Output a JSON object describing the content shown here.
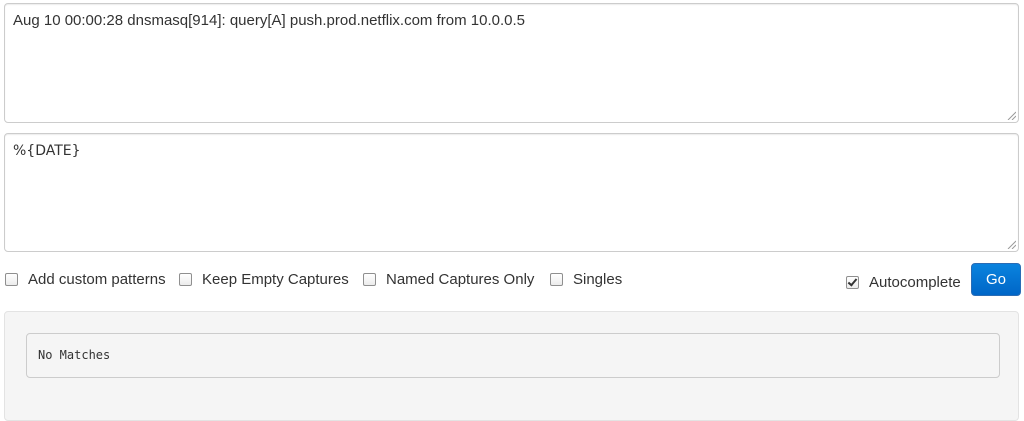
{
  "input_text": "Aug 10 00:00:28 dnsmasq[914]: query[A] push.prod.netflix.com from 10.0.0.5",
  "pattern_text": "%{DATE}",
  "options": [
    {
      "label": "Add custom patterns",
      "checked": false
    },
    {
      "label": "Keep Empty Captures",
      "checked": false
    },
    {
      "label": "Named Captures Only",
      "checked": false
    },
    {
      "label": "Singles",
      "checked": false
    }
  ],
  "autocomplete": {
    "label": "Autocomplete",
    "checked": true
  },
  "go_button": {
    "label": "Go"
  },
  "result": {
    "text": "No Matches"
  },
  "colors": {
    "accent": "#0a7bd8",
    "panel_bg": "#f5f5f5",
    "border": "#cccccc",
    "text": "#333333"
  }
}
